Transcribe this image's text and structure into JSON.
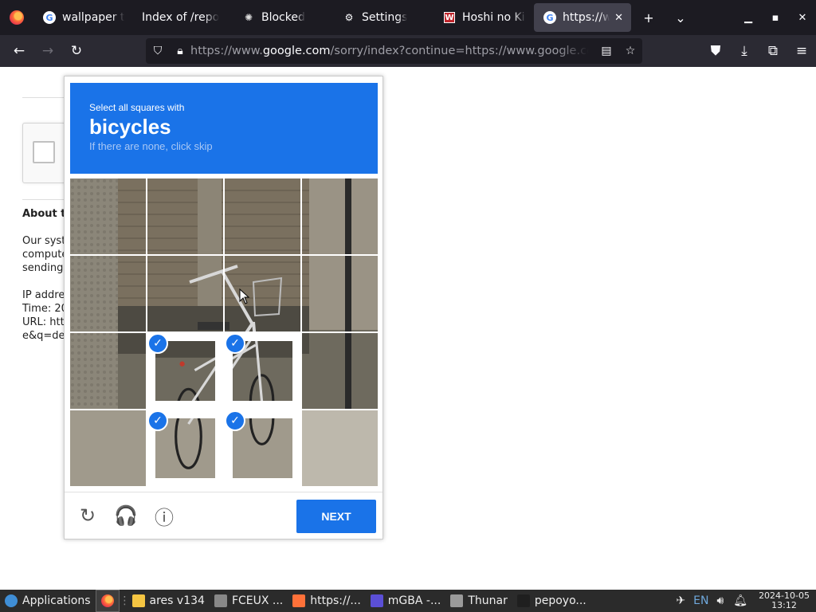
{
  "browser": {
    "tabs": [
      {
        "label": "wallpaper to",
        "icon": "google-icon",
        "active": false
      },
      {
        "label": "Index of /repo",
        "icon": "none",
        "active": false
      },
      {
        "label": "Blocked",
        "icon": "blocked-icon",
        "active": false
      },
      {
        "label": "Settings",
        "icon": "gear-icon",
        "active": false
      },
      {
        "label": "Hoshi no Kir",
        "icon": "wiki-icon",
        "active": false
      },
      {
        "label": "https://ww",
        "icon": "google-icon",
        "active": true
      }
    ],
    "new_tab": "+",
    "list_tabs": "⌄",
    "url_prefix": "https://www.",
    "url_domain": "google.com",
    "url_rest": "/sorry/index?continue=https://www.google.com/search"
  },
  "page": {
    "about_heading": "About t",
    "body_lines": "Our syst\ncomputer\nsending",
    "info_lines": "IP addre\nTime: 20\nURL: htt\ne&q=de"
  },
  "captcha": {
    "prompt_small": "Select all squares with",
    "prompt_object": "bicycles",
    "prompt_hint": "If there are none, click skip",
    "next_label": "NEXT",
    "selected_tiles": [
      9,
      10,
      13,
      14
    ],
    "reload_label": "↻",
    "audio_label": "🎧",
    "info_label": "ⓘ"
  },
  "taskbar": {
    "applications_label": "Applications",
    "items": [
      {
        "label": "ares v134",
        "color": "#f5c542"
      },
      {
        "label": "FCEUX ...",
        "color": "#888888"
      },
      {
        "label": "https://...",
        "color": "#ff7139"
      },
      {
        "label": "mGBA -...",
        "color": "#5b4fd6"
      },
      {
        "label": "Thunar",
        "color": "#9a9a9a"
      },
      {
        "label": "pepoyo...",
        "color": "#1f1f1f"
      }
    ],
    "lang": "EN",
    "date": "2024-10-05",
    "time": "13:12"
  },
  "colors": {
    "accent": "#1a73e8",
    "tabbar": "#1c1b22",
    "navbar": "#2b2a33"
  }
}
